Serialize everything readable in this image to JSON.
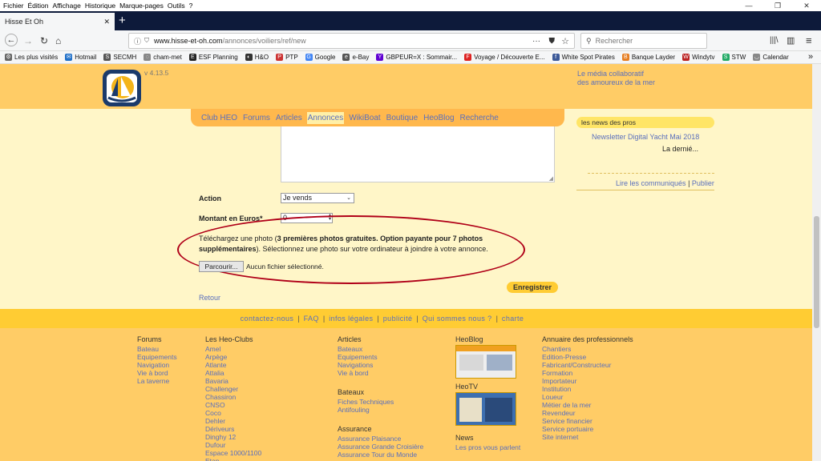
{
  "menu": [
    "Fichier",
    "Édition",
    "Affichage",
    "Historique",
    "Marque-pages",
    "Outils",
    "?"
  ],
  "window_controls": [
    "—",
    "❐",
    "✕"
  ],
  "tab": {
    "title": "Hisse Et Oh",
    "close": "✕",
    "new_tab": "+"
  },
  "nav": {
    "back": "←",
    "forward": "→",
    "reload": "↻",
    "home": "⌂",
    "url_domain": "www.hisse-et-oh.com",
    "url_path": "/annonces/voiliers/ref/new",
    "url_dots": "···",
    "star": "☆",
    "search_placeholder": "Rechercher",
    "library": "|||\\",
    "sidebar": "▥",
    "menu": "≡"
  },
  "bookmarks": [
    {
      "label": "Les plus visités",
      "icon": "⚙",
      "color": "#666"
    },
    {
      "label": "Hotmail",
      "icon": "✉",
      "color": "#1e6fc8"
    },
    {
      "label": "SECMH",
      "icon": "S",
      "color": "#555"
    },
    {
      "label": "cham-met",
      "icon": "◌",
      "color": "#888"
    },
    {
      "label": "ESF Planning",
      "icon": "E",
      "color": "#222"
    },
    {
      "label": "H&O",
      "icon": "◐",
      "color": "#333"
    },
    {
      "label": "PTP",
      "icon": "P",
      "color": "#c33"
    },
    {
      "label": "Google",
      "icon": "G",
      "color": "#4285f4"
    },
    {
      "label": "e-Bay",
      "icon": "e",
      "color": "#555"
    },
    {
      "label": "GBPEUR=X : Sommair...",
      "icon": "Y",
      "color": "#6001d2"
    },
    {
      "label": "Voyage / Découverte E...",
      "icon": "F",
      "color": "#d22"
    },
    {
      "label": "White Spot Pirates",
      "icon": "f",
      "color": "#3b5998"
    },
    {
      "label": "Banque Layder",
      "icon": "B",
      "color": "#e67e22"
    },
    {
      "label": "Windytv",
      "icon": "W",
      "color": "#b22"
    },
    {
      "label": "STW",
      "icon": "S",
      "color": "#2a6"
    },
    {
      "label": "Calendar",
      "icon": "◡",
      "color": "#888"
    }
  ],
  "bookmarks_more": "»",
  "site": {
    "version": "v 4.13.5",
    "tagline_1": "Le média collaboratif",
    "tagline_2": "des amoureux de la mer",
    "nav": [
      "Club HEO",
      "Forums",
      "Articles",
      "Annonces",
      "WikiBoat",
      "Boutique",
      "HeoBlog",
      "Recherche"
    ],
    "nav_active": "Annonces"
  },
  "form": {
    "action_label": "Action",
    "action_value": "Je vends",
    "montant_label": "Montant en Euros*",
    "montant_value": "0",
    "photo_text_1": "Téléchargez une photo (",
    "photo_text_bold": "3 premières photos gratuites. Option payante pour 7 photos supplémentaires",
    "photo_text_2": "). Sélectionnez une photo sur votre ordinateur à joindre à votre annonce.",
    "browse_button": "Parcourir...",
    "file_status": "Aucun fichier sélectionné.",
    "submit": "Enregistrer",
    "back": "Retour"
  },
  "sidebar": {
    "news_title": "les news des pros",
    "news_item": "Newsletter Digital Yacht Mai 2018",
    "news_sub": "La dernié...",
    "read_link": "Lire les communiqués",
    "publish_link": "Publier"
  },
  "footer_links": [
    "contactez-nous",
    "FAQ",
    "infos légales",
    "publicité",
    "Qui sommes nous ?",
    "charte"
  ],
  "footer": {
    "forums": {
      "title": "Forums",
      "items": [
        "Bateau",
        "Equipements",
        "Navigation",
        "Vie à bord",
        "La taverne"
      ]
    },
    "clubs": {
      "title": "Les Heo-Clubs",
      "items": [
        "Amel",
        "Arpège",
        "Atlante",
        "Attalia",
        "Bavaria",
        "Challenger",
        "Chassiron",
        "CNSO",
        "Coco",
        "Dehler",
        "Dériveurs",
        "Dinghy 12",
        "Dufour",
        "Espace 1000/1100",
        "Etap"
      ]
    },
    "articles": {
      "title": "Articles",
      "items": [
        "Bateaux",
        "Equipements",
        "Navigations",
        "Vie à bord"
      ]
    },
    "bateaux": {
      "title": "Bateaux",
      "items": [
        "Fiches Techniques",
        "Antifouling"
      ]
    },
    "assurance": {
      "title": "Assurance",
      "items": [
        "Assurance Plaisance",
        "Assurance Grande Croisière",
        "Assurance Tour du Monde"
      ]
    },
    "heoblog": {
      "title": "HeoBlog"
    },
    "heotv": {
      "title": "HeoTV"
    },
    "news": {
      "title": "News",
      "items": [
        "Les pros vous parlent"
      ]
    },
    "annuaire": {
      "title": "Annuaire des professionnels",
      "items": [
        "Chantiers",
        "Edition-Presse",
        "Fabricant/Constructeur",
        "Formation",
        "Importateur",
        "Institution",
        "Loueur",
        "Métier de la mer",
        "Revendeur",
        "Service financier",
        "Service portuaire",
        "Site internet"
      ]
    }
  }
}
